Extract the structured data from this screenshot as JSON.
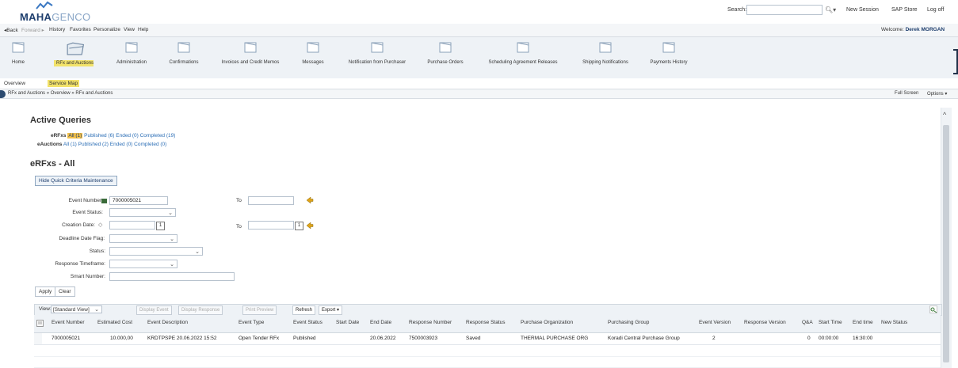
{
  "brand": {
    "name_bold": "MAHA",
    "name_light": "GENCO"
  },
  "header": {
    "search_label": "Search:",
    "search_value": "",
    "links": {
      "new_session": "New Session",
      "sap_store": "SAP Store",
      "log_off": "Log off"
    }
  },
  "menu": {
    "items": [
      "Back",
      "Forward",
      "History",
      "Favorites",
      "Personalize",
      "View",
      "Help"
    ],
    "welcome_prefix": "Welcome:",
    "user": "Derek MORGAN"
  },
  "nav": {
    "items": [
      "Home",
      "RFx and Auctions",
      "Administration",
      "Confirmations",
      "Invoices and Credit Memos",
      "Messages",
      "Notification from Purchaser",
      "Purchase Orders",
      "Scheduling Agreement Releases",
      "Shipping Notifications",
      "Payments History"
    ]
  },
  "subnav": {
    "overview": "Overview",
    "service_map": "Service Map"
  },
  "breadcrumb": {
    "path": "RFx and Auctions  »  Overview  »  RFx and Auctions",
    "full_screen": "Full Screen",
    "options": "Options ▾"
  },
  "queries": {
    "title": "Active Queries",
    "erfx_label": "eRFxs",
    "erfx": {
      "all": "All (1)",
      "published": "Published (6)",
      "ended": "Ended (0)",
      "completed": "Completed (19)"
    },
    "eauction_label": "eAuctions",
    "eauction": {
      "all": "All (1)",
      "published": "Published (2)",
      "ended": "Ended (0)",
      "completed": "Completed (0)"
    }
  },
  "section": {
    "title": "eRFxs - All",
    "hide_btn": "Hide Quick Criteria Maintenance"
  },
  "form": {
    "event_number_label": "Event Number:",
    "event_number_value": "7000005021",
    "to_label": "To",
    "event_status_label": "Event Status:",
    "creation_date_label": "Creation Date:",
    "deadline_flag_label": "Deadline Date Flag:",
    "status_label": "Status:",
    "response_timeframe_label": "Response Timeframe:",
    "smart_number_label": "Smart Number:",
    "apply": "Apply",
    "clear": "Clear"
  },
  "toolbar": {
    "view_label": "View:",
    "view_value": "[Standard View]",
    "display_event": "Display Event",
    "display_response": "Display Response",
    "print_preview": "Print Preview",
    "refresh": "Refresh",
    "export": "Export"
  },
  "table": {
    "columns": [
      "Event Number",
      "Estimated Cost",
      "Event Description",
      "Event Type",
      "Event Status",
      "Start Date",
      "End Date",
      "Response Number",
      "Response Status",
      "Purchase Organization",
      "Purchasing Group",
      "Event Version",
      "Response Version",
      "Q&A",
      "Start Time",
      "End time",
      "New Status"
    ],
    "rows": [
      {
        "event_number": "7000005021",
        "estimated_cost": "10.000,00",
        "event_description": "KRDTPSPE 20.06.2022 15:52",
        "event_type": "Open Tender RFx",
        "event_status": "Published",
        "start_date": "",
        "end_date": "20.06.2022",
        "response_number": "7500003923",
        "response_status": "Saved",
        "purchase_org": "THERMAL PURCHASE ORG",
        "purchasing_group": "Koradi Central Purchase Group",
        "event_version": "2",
        "response_version": "",
        "qa": "0",
        "start_time": "00:00:00",
        "end_time": "16:30:00",
        "new_status": ""
      }
    ]
  },
  "colors": {
    "highlight": "#f2e26a",
    "link": "#2a6db5",
    "brand": "#1f3f6e"
  }
}
